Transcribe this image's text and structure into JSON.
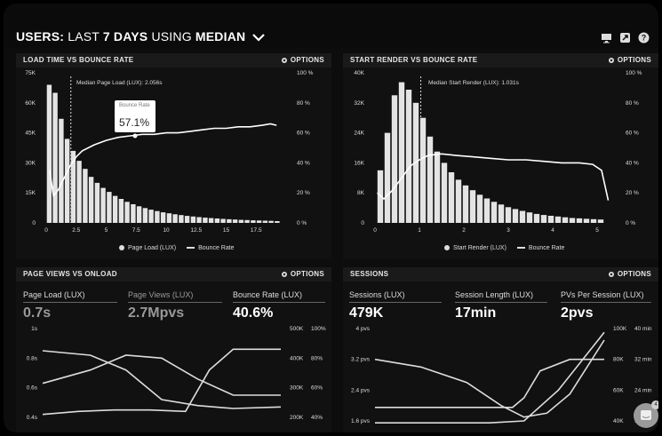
{
  "header": {
    "users": "USERS:",
    "last": "LAST",
    "days": "7 DAYS",
    "using": "USING",
    "median": "MEDIAN"
  },
  "icons": [
    "monitor-icon",
    "share-icon",
    "help-icon"
  ],
  "panels": {
    "p1": {
      "title": "LOAD TIME VS BOUNCE RATE",
      "options": "OPTIONS"
    },
    "p2": {
      "title": "START RENDER VS BOUNCE RATE",
      "options": "OPTIONS"
    },
    "p3": {
      "title": "PAGE VIEWS VS ONLOAD",
      "options": "OPTIONS"
    },
    "p4": {
      "title": "SESSIONS",
      "options": "OPTIONS"
    }
  },
  "load_chart": {
    "median_note": "Median Page Load (LUX): 2.056s",
    "tooltip_label": "Bounce Rate",
    "tooltip_value": "57.1%",
    "legend_bar": "Page Load (LUX)",
    "legend_line": "Bounce Rate"
  },
  "render_chart": {
    "median_note": "Median Start Render (LUX): 1.031s",
    "legend_bar": "Start Render (LUX)",
    "legend_line": "Bounce Rate"
  },
  "pageviews_metrics": [
    {
      "label": "Page Load (LUX)",
      "value": "0.7s"
    },
    {
      "label": "Page Views (LUX)",
      "value": "2.7Mpvs"
    },
    {
      "label": "Bounce Rate (LUX)",
      "value": "40.6%"
    }
  ],
  "sessions_metrics": [
    {
      "label": "Sessions (LUX)",
      "value": "479K"
    },
    {
      "label": "Session Length (LUX)",
      "value": "17min"
    },
    {
      "label": "PVs Per Session (LUX)",
      "value": "2pvs"
    }
  ],
  "chat": {
    "badge": "4"
  },
  "chart_data": [
    {
      "type": "bar",
      "title": "LOAD TIME VS BOUNCE RATE",
      "x_ticks": [
        "0",
        "2.5",
        "5",
        "7.5",
        "10",
        "12.5",
        "15",
        "17.5"
      ],
      "y_ticks": [
        "0",
        "15K",
        "30K",
        "45K",
        "60K",
        "75K"
      ],
      "y2_ticks": [
        "0 %",
        "20 %",
        "40 %",
        "60 %",
        "80 %",
        "100 %"
      ],
      "xlim": [
        0,
        20
      ],
      "ylim": [
        0,
        75000
      ],
      "bar_x": [
        0.25,
        0.75,
        1.25,
        1.75,
        2.25,
        2.75,
        3.25,
        3.75,
        4.25,
        4.75,
        5.25,
        5.75,
        6.25,
        6.75,
        7.25,
        7.75,
        8.25,
        8.75,
        9.25,
        9.75,
        10.25,
        10.75,
        11.25,
        11.75,
        12.25,
        12.75,
        13.25,
        13.75,
        14.25,
        14.75,
        15.25,
        15.75,
        16.25,
        16.75,
        17.25,
        17.75,
        18.25,
        18.75,
        19.25
      ],
      "bar_values": [
        69000,
        65000,
        52000,
        42000,
        36000,
        31000,
        27000,
        23000,
        20000,
        17500,
        15500,
        13500,
        12000,
        10500,
        9300,
        8300,
        7400,
        6600,
        5900,
        5300,
        4800,
        4300,
        3900,
        3500,
        3200,
        2900,
        2600,
        2400,
        2200,
        2000,
        1800,
        1700,
        1500,
        1400,
        1300,
        1200,
        1100,
        1000,
        900
      ],
      "series": [
        {
          "name": "Page Load (LUX)",
          "kind": "bar"
        },
        {
          "name": "Bounce Rate",
          "kind": "line",
          "x": [
            0.3,
            0.6,
            1.0,
            1.5,
            2.0,
            2.5,
            3.0,
            4.0,
            5.0,
            6.0,
            7.0,
            8.0,
            9.0,
            10.0,
            11.0,
            12.0,
            13.0,
            14.0,
            15.0,
            16.0,
            17.0,
            18.0,
            18.7,
            19.2
          ],
          "y": [
            35,
            18,
            22,
            30,
            38,
            44,
            48,
            52,
            55,
            57,
            58,
            59,
            59,
            60,
            60,
            61,
            62,
            63,
            63,
            64,
            64,
            65,
            66,
            65
          ]
        }
      ],
      "y2lim": [
        0,
        100
      ],
      "legend": "bottom"
    },
    {
      "type": "bar",
      "title": "START RENDER VS BOUNCE RATE",
      "x_ticks": [
        "0",
        "1",
        "2",
        "3",
        "4",
        "5"
      ],
      "y_ticks": [
        "0",
        "8K",
        "16K",
        "24K",
        "32K",
        "40K"
      ],
      "y2_ticks": [
        "0 %",
        "20 %",
        "40 %",
        "60 %",
        "80 %",
        "100 %"
      ],
      "xlim": [
        0,
        5.4
      ],
      "ylim": [
        0,
        40000
      ],
      "bar_x": [
        0.12,
        0.28,
        0.44,
        0.6,
        0.76,
        0.92,
        1.08,
        1.24,
        1.4,
        1.56,
        1.72,
        1.88,
        2.04,
        2.2,
        2.36,
        2.52,
        2.68,
        2.84,
        3.0,
        3.16,
        3.32,
        3.48,
        3.64,
        3.8,
        3.96,
        4.12,
        4.28,
        4.44,
        4.6,
        4.76,
        4.92,
        5.08
      ],
      "bar_values": [
        14000,
        24000,
        34000,
        37500,
        35500,
        32000,
        28000,
        23000,
        19000,
        16000,
        13500,
        11500,
        10000,
        8700,
        7500,
        6500,
        5600,
        4900,
        4200,
        3700,
        3200,
        2800,
        2400,
        2100,
        1900,
        1700,
        1500,
        1300,
        1200,
        1100,
        1000,
        900
      ],
      "series": [
        {
          "name": "Start Render (LUX)",
          "kind": "bar"
        },
        {
          "name": "Bounce Rate",
          "kind": "line",
          "x": [
            0.05,
            0.2,
            0.4,
            0.6,
            0.8,
            1.0,
            1.2,
            1.5,
            1.8,
            2.2,
            2.6,
            3.0,
            3.4,
            3.8,
            4.2,
            4.6,
            4.9,
            5.1,
            5.25
          ],
          "y": [
            20,
            16,
            22,
            30,
            38,
            42,
            45,
            46,
            45,
            44,
            43,
            42,
            42,
            41,
            40,
            40,
            39,
            35,
            15
          ]
        }
      ],
      "y2lim": [
        0,
        100
      ],
      "legend": "bottom"
    },
    {
      "type": "line",
      "title": "PAGE VIEWS VS ONLOAD",
      "y_ticks": [
        "1s",
        "0.8s",
        "0.6s",
        "0.4s"
      ],
      "y2_ticks": [
        "500K",
        "400K",
        "300K",
        "200K"
      ],
      "y3_ticks": [
        "100%",
        "80%",
        "60%",
        "40%"
      ],
      "series": [
        {
          "name": "Page Load (LUX)",
          "x": [
            0,
            0.2,
            0.35,
            0.5,
            0.65,
            0.8,
            1.0
          ],
          "y": [
            0.85,
            0.82,
            0.72,
            0.52,
            0.48,
            0.46,
            0.47
          ]
        },
        {
          "name": "Page Views (LUX)",
          "x": [
            0,
            0.2,
            0.35,
            0.5,
            0.65,
            0.8,
            1.0
          ],
          "y": [
            0.63,
            0.72,
            0.82,
            0.8,
            0.66,
            0.55,
            0.55
          ]
        },
        {
          "name": "Bounce Rate (LUX)",
          "x": [
            0,
            0.15,
            0.3,
            0.45,
            0.6,
            0.7,
            0.8,
            1.0
          ],
          "y": [
            0.42,
            0.44,
            0.45,
            0.45,
            0.44,
            0.72,
            0.86,
            0.86
          ]
        }
      ]
    },
    {
      "type": "line",
      "title": "SESSIONS",
      "y_ticks": [
        "4 pvs",
        "3.2 pvs",
        "2.4 pvs",
        "1.6 pvs"
      ],
      "y2_ticks": [
        "100K",
        "80K",
        "60K",
        "40K"
      ],
      "y3_ticks": [
        "40 min",
        "32 min",
        "24 min",
        "16 min"
      ],
      "series": [
        {
          "name": "Sessions (LUX)",
          "x": [
            0,
            0.2,
            0.4,
            0.55,
            0.65,
            0.75,
            0.85,
            1.0
          ],
          "y": [
            3.2,
            3.0,
            2.6,
            2.0,
            1.7,
            1.8,
            2.3,
            3.7
          ]
        },
        {
          "name": "Session Length (LUX)",
          "x": [
            0,
            0.3,
            0.6,
            0.65,
            0.72,
            0.85,
            1.0
          ],
          "y": [
            1.95,
            1.95,
            1.95,
            2.2,
            2.9,
            3.2,
            3.2
          ]
        },
        {
          "name": "PVs Per Session (LUX)",
          "x": [
            0,
            0.5,
            0.65,
            0.8,
            1.0
          ],
          "y": [
            1.55,
            1.55,
            1.6,
            2.4,
            3.9
          ]
        }
      ]
    }
  ]
}
